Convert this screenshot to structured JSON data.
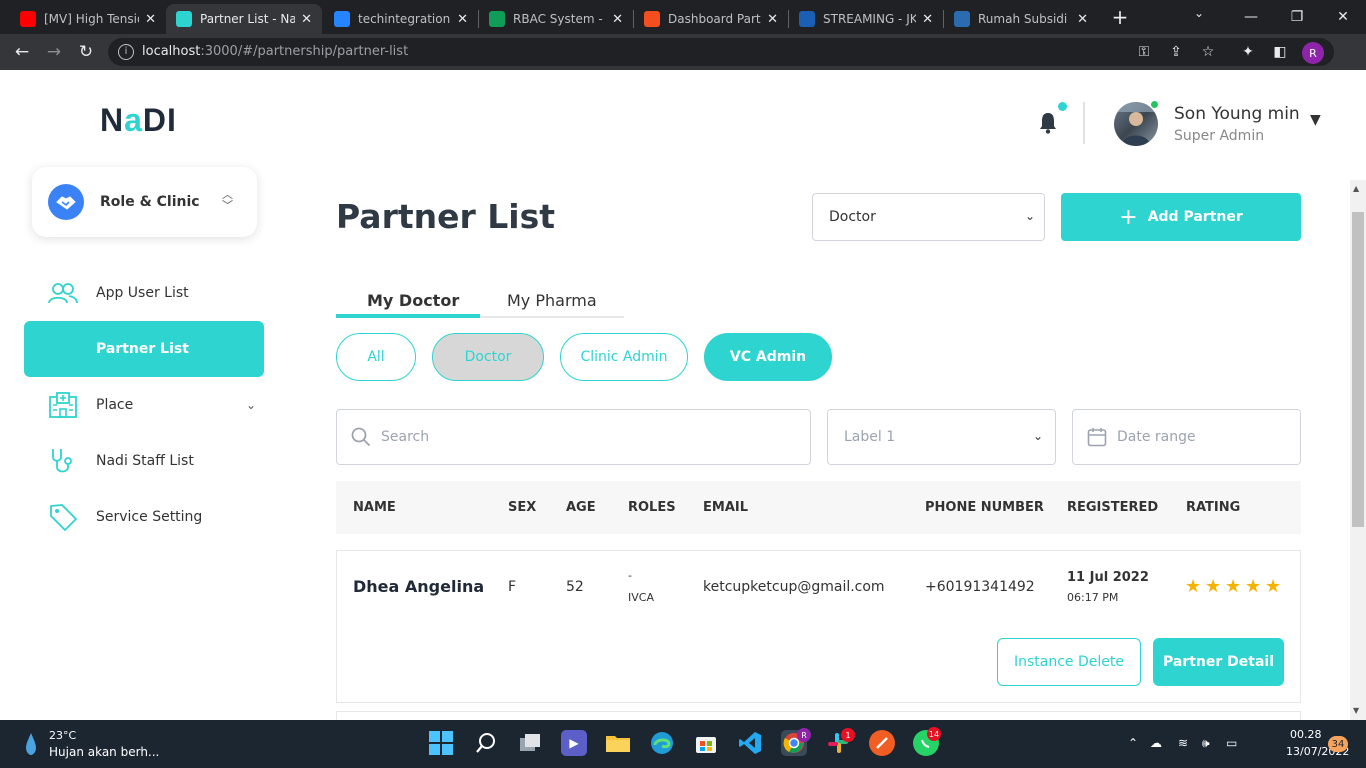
{
  "browser": {
    "tabs": [
      {
        "title": "[MV] High Tensio",
        "icon": "youtube-icon",
        "color": "#ff0000"
      },
      {
        "title": "Partner List - Nad",
        "icon": "nadi-icon",
        "color": "#2dd4d0"
      },
      {
        "title": "techintegration /",
        "icon": "jira-icon",
        "color": "#2684ff"
      },
      {
        "title": "RBAC System - G",
        "icon": "sheets-icon",
        "color": "#0f9d58"
      },
      {
        "title": "Dashboard Partne",
        "icon": "figma-icon",
        "color": "#f24e1e"
      },
      {
        "title": "STREAMING - JKT",
        "icon": "streaming-icon",
        "color": "#1a5fb4"
      },
      {
        "title": "Rumah Subsidi D",
        "icon": "rumah-icon",
        "color": "#2b6cb0"
      }
    ],
    "url_host": "localhost",
    "url_path": ":3000/#/partnership/partner-list",
    "profile_initial": "R"
  },
  "app": {
    "logo_prefix": "N",
    "logo_a": "a",
    "logo_suffix": "DI",
    "role_card_label": "Role & Clinic",
    "nav": [
      {
        "label": "App User List",
        "icon": "users-icon"
      },
      {
        "label": "Partner List",
        "icon": "partner-icon"
      },
      {
        "label": "Place",
        "icon": "hospital-icon"
      },
      {
        "label": "Nadi Staff List",
        "icon": "stethoscope-icon"
      },
      {
        "label": "Service Setting",
        "icon": "tag-icon"
      }
    ],
    "user": {
      "name": "Son Young min",
      "role": "Super Admin"
    },
    "page_title": "Partner List",
    "type_select": "Doctor",
    "add_button": "Add Partner",
    "tabs": [
      "My Doctor",
      "My Pharma"
    ],
    "filters": [
      "All",
      "Doctor",
      "Clinic Admin",
      "VC Admin"
    ],
    "search_placeholder": "Search",
    "label_select": "Label 1",
    "date_placeholder": "Date range",
    "table": {
      "headers": [
        "NAME",
        "SEX",
        "AGE",
        "ROLES",
        "EMAIL",
        "PHONE NUMBER",
        "REGISTERED",
        "RATING"
      ],
      "rows": [
        {
          "name": "Dhea Angelina",
          "sex": "F",
          "age": "52",
          "roles_top": "-",
          "roles_bottom": "IVCA",
          "email": "ketcupketcup@gmail.com",
          "phone": "+60191341492",
          "reg_date": "11 Jul 2022",
          "reg_time": "06:17 PM",
          "rating": 5
        }
      ],
      "row_actions": [
        "Instance Delete",
        "Partner Detail"
      ]
    },
    "accent": "#2dd4d0"
  },
  "taskbar": {
    "temp": "23°C",
    "weather": "Hujan akan berh...",
    "time": "00.28",
    "date": "13/07/2022",
    "notifications": "34",
    "slack_badge": "1",
    "whatsapp_badge": "14"
  }
}
